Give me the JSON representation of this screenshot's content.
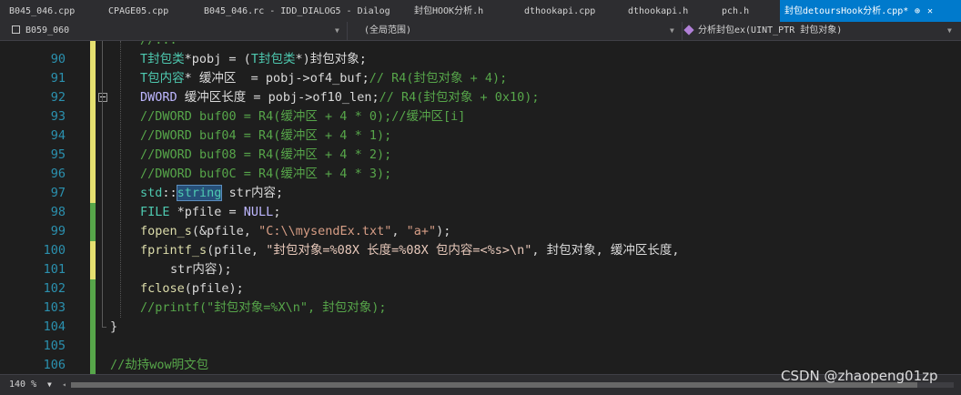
{
  "tabs": [
    {
      "label": "B045_046.cpp",
      "active": false
    },
    {
      "label": "CPAGE05.cpp",
      "active": false
    },
    {
      "label": "B045_046.rc - IDD_DIALOG5 - Dialog",
      "active": false
    },
    {
      "label": "封包HOOK分析.h",
      "active": false
    },
    {
      "label": "dthookapi.cpp",
      "active": false
    },
    {
      "label": "dthookapi.h",
      "active": false
    },
    {
      "label": "pch.h",
      "active": false
    },
    {
      "label": "封包detoursHook分析.cpp*",
      "active": true
    }
  ],
  "tab_pin": "⊕",
  "tab_close": "✕",
  "navbar": {
    "project": "B059_060",
    "scope": "(全局范围)",
    "member": "分析封包ex(UINT_PTR 封包对象)",
    "member_icon": "purple-cube-icon"
  },
  "editor": {
    "selected_word": "string",
    "change_bar_colors": {
      "saved": "#57a64a",
      "unsaved": "#e5e070"
    },
    "lines": [
      {
        "n": "",
        "bar": "unsaved",
        "tokens": [
          {
            "t": "//...",
            "c": "c-cm"
          }
        ]
      },
      {
        "n": "90",
        "bar": "unsaved",
        "tokens": [
          {
            "t": "T封包类",
            "c": "c-type"
          },
          {
            "t": "*",
            "c": "c-id"
          },
          {
            "t": "pobj",
            "c": "c-id"
          },
          {
            "t": " = (",
            "c": "c-id"
          },
          {
            "t": "T封包类",
            "c": "c-type"
          },
          {
            "t": "*)",
            "c": "c-id"
          },
          {
            "t": "封包对象",
            "c": "c-id"
          },
          {
            "t": ";",
            "c": "c-id"
          }
        ]
      },
      {
        "n": "91",
        "bar": "unsaved",
        "tokens": [
          {
            "t": "T包内容",
            "c": "c-type"
          },
          {
            "t": "* 缓冲区  = pobj->",
            "c": "c-id"
          },
          {
            "t": "of4_buf",
            "c": "c-mem"
          },
          {
            "t": ";",
            "c": "c-id"
          },
          {
            "t": "// R4(封包对象 + 4);",
            "c": "c-cm"
          }
        ]
      },
      {
        "n": "92",
        "bar": "unsaved",
        "fold": true,
        "tokens": [
          {
            "t": "DWORD",
            "c": "c-macro"
          },
          {
            "t": " 缓冲区长度 = pobj->",
            "c": "c-id"
          },
          {
            "t": "of10_len",
            "c": "c-mem"
          },
          {
            "t": ";",
            "c": "c-id"
          },
          {
            "t": "// R4(封包对象 + 0x10);",
            "c": "c-cm"
          }
        ]
      },
      {
        "n": "93",
        "bar": "unsaved",
        "tokens": [
          {
            "t": "//DWORD buf00 = R4(缓冲区 + 4 * 0);//缓冲区[i]",
            "c": "c-cm"
          }
        ]
      },
      {
        "n": "94",
        "bar": "unsaved",
        "tokens": [
          {
            "t": "//DWORD buf04 = R4(缓冲区 + 4 * 1);",
            "c": "c-cm"
          }
        ]
      },
      {
        "n": "95",
        "bar": "unsaved",
        "tokens": [
          {
            "t": "//DWORD buf08 = R4(缓冲区 + 4 * 2);",
            "c": "c-cm"
          }
        ]
      },
      {
        "n": "96",
        "bar": "unsaved",
        "tokens": [
          {
            "t": "//DWORD buf0C = R4(缓冲区 + 4 * 3);",
            "c": "c-cm"
          }
        ]
      },
      {
        "n": "97",
        "bar": "unsaved",
        "tokens": [
          {
            "t": "std",
            "c": "c-type"
          },
          {
            "t": "::",
            "c": "c-id"
          },
          {
            "t": "string",
            "c": "c-type",
            "sel": true
          },
          {
            "t": " str内容;",
            "c": "c-id"
          }
        ]
      },
      {
        "n": "98",
        "bar": "saved",
        "tokens": [
          {
            "t": "FILE",
            "c": "c-type"
          },
          {
            "t": " *pfile = ",
            "c": "c-id"
          },
          {
            "t": "NULL",
            "c": "c-macro"
          },
          {
            "t": ";",
            "c": "c-id"
          }
        ]
      },
      {
        "n": "99",
        "bar": "saved",
        "tokens": [
          {
            "t": "fopen_s",
            "c": "c-fn"
          },
          {
            "t": "(&pfile, ",
            "c": "c-id"
          },
          {
            "t": "\"C:\\\\mysendEx.txt\"",
            "c": "c-str"
          },
          {
            "t": ", ",
            "c": "c-id"
          },
          {
            "t": "\"a+\"",
            "c": "c-str"
          },
          {
            "t": ");",
            "c": "c-id"
          }
        ]
      },
      {
        "n": "100",
        "bar": "unsaved",
        "tokens": [
          {
            "t": "fprintf_s",
            "c": "c-fn"
          },
          {
            "t": "(pfile, ",
            "c": "c-id"
          },
          {
            "t": "\"封包对象=%08X 长度=%08X 包内容=<%s>\\n\"",
            "c": "c-fmt"
          },
          {
            "t": ", 封包对象, 缓冲区长度,",
            "c": "c-id"
          }
        ]
      },
      {
        "n": "101",
        "bar": "unsaved",
        "indent": 2,
        "tokens": [
          {
            "t": "str内容);",
            "c": "c-id"
          }
        ]
      },
      {
        "n": "102",
        "bar": "saved",
        "tokens": [
          {
            "t": "fclose",
            "c": "c-fn"
          },
          {
            "t": "(pfile);",
            "c": "c-id"
          }
        ]
      },
      {
        "n": "103",
        "bar": "saved",
        "tokens": [
          {
            "t": "//printf(\"封包对象=%X\\n\", 封包对象);",
            "c": "c-cm"
          }
        ]
      },
      {
        "n": "104",
        "bar": "saved",
        "indent": -2,
        "tokens": [
          {
            "t": "}",
            "c": "c-id"
          }
        ]
      },
      {
        "n": "105",
        "bar": "saved",
        "tokens": []
      },
      {
        "n": "106",
        "bar": "saved",
        "indent": -2,
        "tokens": [
          {
            "t": "//劫持wow明文包",
            "c": "c-cm"
          }
        ]
      }
    ]
  },
  "status": {
    "zoom": "140 %"
  },
  "watermark": "CSDN @zhaopeng01zp"
}
